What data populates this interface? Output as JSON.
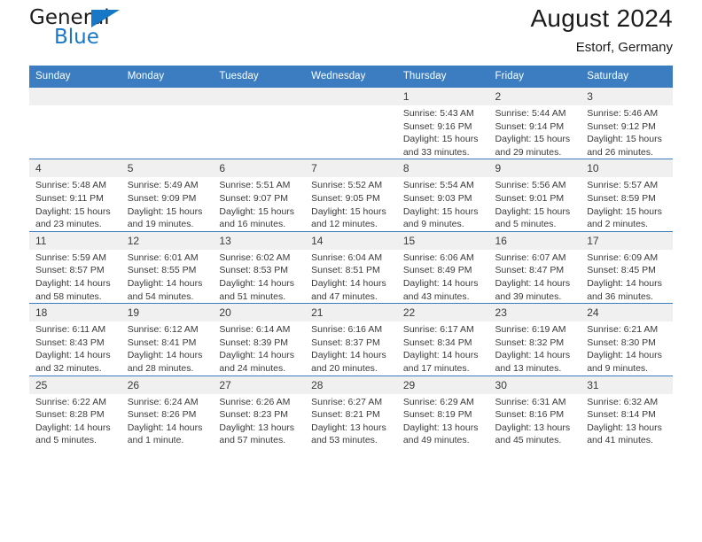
{
  "brand": {
    "name_top": "General",
    "name_bottom": "Blue",
    "triangle_color": "#1878c8",
    "text_color": "#1b1b1b"
  },
  "header": {
    "title": "August 2024",
    "subtitle": "Estorf, Germany"
  },
  "colors": {
    "header_row_bg": "#3b7dc0",
    "header_row_text": "#ffffff",
    "daynum_bg": "#f0f0f0",
    "grid_line": "#3b7dc0",
    "body_text": "#3a3a3a"
  },
  "weekday_headers": [
    "Sunday",
    "Monday",
    "Tuesday",
    "Wednesday",
    "Thursday",
    "Friday",
    "Saturday"
  ],
  "weeks": [
    [
      {
        "day": "",
        "lines": []
      },
      {
        "day": "",
        "lines": []
      },
      {
        "day": "",
        "lines": []
      },
      {
        "day": "",
        "lines": []
      },
      {
        "day": "1",
        "lines": [
          "Sunrise: 5:43 AM",
          "Sunset: 9:16 PM",
          "Daylight: 15 hours",
          "and 33 minutes."
        ]
      },
      {
        "day": "2",
        "lines": [
          "Sunrise: 5:44 AM",
          "Sunset: 9:14 PM",
          "Daylight: 15 hours",
          "and 29 minutes."
        ]
      },
      {
        "day": "3",
        "lines": [
          "Sunrise: 5:46 AM",
          "Sunset: 9:12 PM",
          "Daylight: 15 hours",
          "and 26 minutes."
        ]
      }
    ],
    [
      {
        "day": "4",
        "lines": [
          "Sunrise: 5:48 AM",
          "Sunset: 9:11 PM",
          "Daylight: 15 hours",
          "and 23 minutes."
        ]
      },
      {
        "day": "5",
        "lines": [
          "Sunrise: 5:49 AM",
          "Sunset: 9:09 PM",
          "Daylight: 15 hours",
          "and 19 minutes."
        ]
      },
      {
        "day": "6",
        "lines": [
          "Sunrise: 5:51 AM",
          "Sunset: 9:07 PM",
          "Daylight: 15 hours",
          "and 16 minutes."
        ]
      },
      {
        "day": "7",
        "lines": [
          "Sunrise: 5:52 AM",
          "Sunset: 9:05 PM",
          "Daylight: 15 hours",
          "and 12 minutes."
        ]
      },
      {
        "day": "8",
        "lines": [
          "Sunrise: 5:54 AM",
          "Sunset: 9:03 PM",
          "Daylight: 15 hours",
          "and 9 minutes."
        ]
      },
      {
        "day": "9",
        "lines": [
          "Sunrise: 5:56 AM",
          "Sunset: 9:01 PM",
          "Daylight: 15 hours",
          "and 5 minutes."
        ]
      },
      {
        "day": "10",
        "lines": [
          "Sunrise: 5:57 AM",
          "Sunset: 8:59 PM",
          "Daylight: 15 hours",
          "and 2 minutes."
        ]
      }
    ],
    [
      {
        "day": "11",
        "lines": [
          "Sunrise: 5:59 AM",
          "Sunset: 8:57 PM",
          "Daylight: 14 hours",
          "and 58 minutes."
        ]
      },
      {
        "day": "12",
        "lines": [
          "Sunrise: 6:01 AM",
          "Sunset: 8:55 PM",
          "Daylight: 14 hours",
          "and 54 minutes."
        ]
      },
      {
        "day": "13",
        "lines": [
          "Sunrise: 6:02 AM",
          "Sunset: 8:53 PM",
          "Daylight: 14 hours",
          "and 51 minutes."
        ]
      },
      {
        "day": "14",
        "lines": [
          "Sunrise: 6:04 AM",
          "Sunset: 8:51 PM",
          "Daylight: 14 hours",
          "and 47 minutes."
        ]
      },
      {
        "day": "15",
        "lines": [
          "Sunrise: 6:06 AM",
          "Sunset: 8:49 PM",
          "Daylight: 14 hours",
          "and 43 minutes."
        ]
      },
      {
        "day": "16",
        "lines": [
          "Sunrise: 6:07 AM",
          "Sunset: 8:47 PM",
          "Daylight: 14 hours",
          "and 39 minutes."
        ]
      },
      {
        "day": "17",
        "lines": [
          "Sunrise: 6:09 AM",
          "Sunset: 8:45 PM",
          "Daylight: 14 hours",
          "and 36 minutes."
        ]
      }
    ],
    [
      {
        "day": "18",
        "lines": [
          "Sunrise: 6:11 AM",
          "Sunset: 8:43 PM",
          "Daylight: 14 hours",
          "and 32 minutes."
        ]
      },
      {
        "day": "19",
        "lines": [
          "Sunrise: 6:12 AM",
          "Sunset: 8:41 PM",
          "Daylight: 14 hours",
          "and 28 minutes."
        ]
      },
      {
        "day": "20",
        "lines": [
          "Sunrise: 6:14 AM",
          "Sunset: 8:39 PM",
          "Daylight: 14 hours",
          "and 24 minutes."
        ]
      },
      {
        "day": "21",
        "lines": [
          "Sunrise: 6:16 AM",
          "Sunset: 8:37 PM",
          "Daylight: 14 hours",
          "and 20 minutes."
        ]
      },
      {
        "day": "22",
        "lines": [
          "Sunrise: 6:17 AM",
          "Sunset: 8:34 PM",
          "Daylight: 14 hours",
          "and 17 minutes."
        ]
      },
      {
        "day": "23",
        "lines": [
          "Sunrise: 6:19 AM",
          "Sunset: 8:32 PM",
          "Daylight: 14 hours",
          "and 13 minutes."
        ]
      },
      {
        "day": "24",
        "lines": [
          "Sunrise: 6:21 AM",
          "Sunset: 8:30 PM",
          "Daylight: 14 hours",
          "and 9 minutes."
        ]
      }
    ],
    [
      {
        "day": "25",
        "lines": [
          "Sunrise: 6:22 AM",
          "Sunset: 8:28 PM",
          "Daylight: 14 hours",
          "and 5 minutes."
        ]
      },
      {
        "day": "26",
        "lines": [
          "Sunrise: 6:24 AM",
          "Sunset: 8:26 PM",
          "Daylight: 14 hours",
          "and 1 minute."
        ]
      },
      {
        "day": "27",
        "lines": [
          "Sunrise: 6:26 AM",
          "Sunset: 8:23 PM",
          "Daylight: 13 hours",
          "and 57 minutes."
        ]
      },
      {
        "day": "28",
        "lines": [
          "Sunrise: 6:27 AM",
          "Sunset: 8:21 PM",
          "Daylight: 13 hours",
          "and 53 minutes."
        ]
      },
      {
        "day": "29",
        "lines": [
          "Sunrise: 6:29 AM",
          "Sunset: 8:19 PM",
          "Daylight: 13 hours",
          "and 49 minutes."
        ]
      },
      {
        "day": "30",
        "lines": [
          "Sunrise: 6:31 AM",
          "Sunset: 8:16 PM",
          "Daylight: 13 hours",
          "and 45 minutes."
        ]
      },
      {
        "day": "31",
        "lines": [
          "Sunrise: 6:32 AM",
          "Sunset: 8:14 PM",
          "Daylight: 13 hours",
          "and 41 minutes."
        ]
      }
    ]
  ]
}
